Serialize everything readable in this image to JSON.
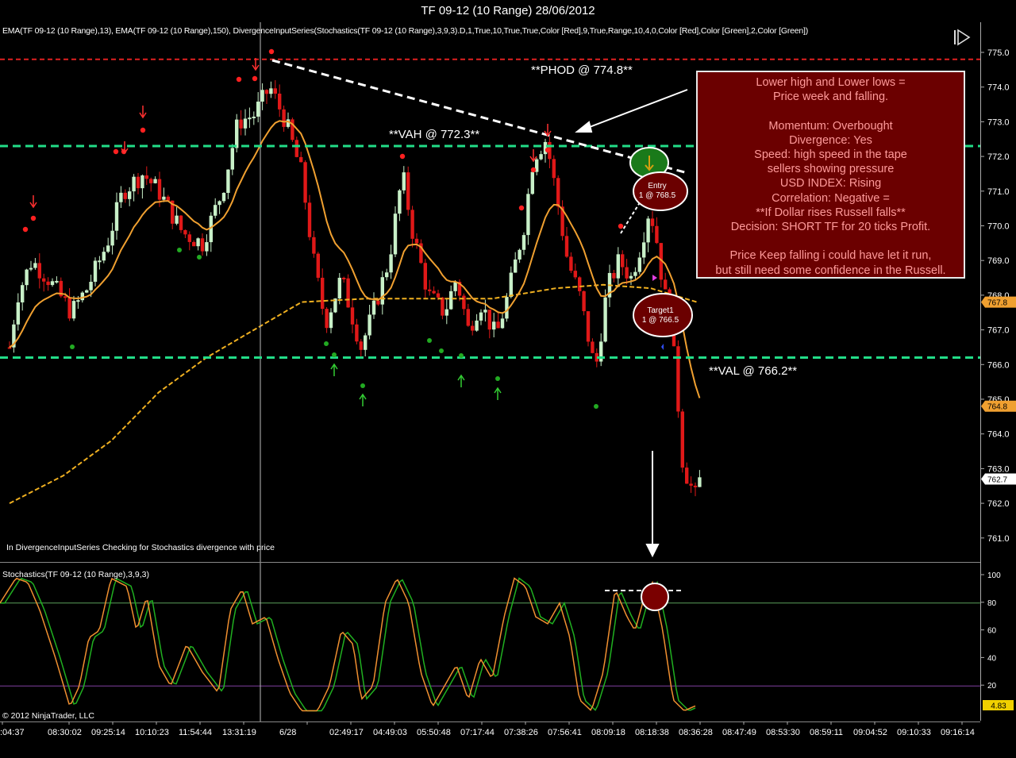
{
  "window": {
    "title": "TF 09-12 (10 Range)  28/06/2012"
  },
  "indicators": {
    "caption": "EMA(TF 09-12 (10 Range),13), EMA(TF 09-12 (10 Range),150), DivergenceInputSeries(Stochastics(TF 09-12 (10 Range),3,9,3).D,1,True,10,True,True,Color [Red],9,True,Range,10,4,0,Color [Red],Color [Green],2,Color [Green])"
  },
  "annotations": {
    "phod": "**PHOD @ 774.8**",
    "vah": "**VAH @ 772.3**",
    "val": "**VAL @ 766.2**",
    "entry_line1": "Entry",
    "entry_line2": "1 @ 768.5",
    "target_line1": "Target1",
    "target_line2": "1 @ 766.5",
    "divergence_note": "In DivergenceInputSeries Checking for Stochastics  divergence with price",
    "copyright": "© 2012 NinjaTrader, LLC"
  },
  "analysis_box": {
    "lines": [
      "Lower high and Lower lows =",
      "Price week and falling.",
      "",
      "Momentum: Overbought",
      "Divergence: Yes",
      "Speed: high speed in the tape",
      "sellers showing pressure",
      "USD INDEX: Rising",
      "Correlation: Negative =",
      "**If Dollar rises Russell falls**",
      "Decision: SHORT TF for 20 ticks Profit.",
      "",
      "Price Keep falling i could have let it run,",
      "but still need some confidence in the Russell."
    ]
  },
  "price_axis": {
    "ticks": [
      "775.0",
      "774.0",
      "773.0",
      "772.0",
      "771.0",
      "770.0",
      "769.0",
      "768.0",
      "767.0",
      "766.0",
      "765.0",
      "764.0",
      "763.0",
      "762.0",
      "761.0"
    ],
    "markers": [
      {
        "label": "767.8",
        "value": 767.8,
        "color": "#f0a030"
      },
      {
        "label": "764.8",
        "value": 764.8,
        "color": "#f0a030"
      },
      {
        "label": "762.7",
        "value": 762.7,
        "color": "#ffffff"
      }
    ]
  },
  "stoch": {
    "title": "Stochastics(TF 09-12 (10 Range),3,9,3)",
    "ticks": [
      "100",
      "80",
      "60",
      "40",
      "20"
    ],
    "marker": {
      "label": "4.83",
      "color": "#f0d000"
    }
  },
  "time_axis": {
    "labels": [
      ":04:37",
      "08:30:02",
      "09:25:14",
      "10:10:23",
      "11:54:44",
      "13:31:19",
      "6/28",
      "02:49:17",
      "04:49:03",
      "05:50:48",
      "07:17:44",
      "07:38:26",
      "07:56:41",
      "08:09:18",
      "08:18:38",
      "08:36:28",
      "08:47:49",
      "08:53:30",
      "08:59:11",
      "09:04:52",
      "09:10:33",
      "09:16:14"
    ]
  },
  "colors": {
    "up_candle": "#c8f0c8",
    "down_candle": "#e01818",
    "ema13": "#f0a030",
    "ema150": "#f0b020",
    "vah_val": "#22dd88",
    "phod": "#e02020",
    "stoch_k": "#f09030",
    "stoch_d": "#20b020"
  },
  "chart_data": {
    "type": "candlestick",
    "levels": {
      "phod": 774.8,
      "vah": 772.3,
      "val": 766.2
    },
    "ylim": [
      760.5,
      775.5
    ],
    "stoch_ylim": [
      0,
      100
    ],
    "stoch_levels": [
      80,
      20
    ]
  }
}
